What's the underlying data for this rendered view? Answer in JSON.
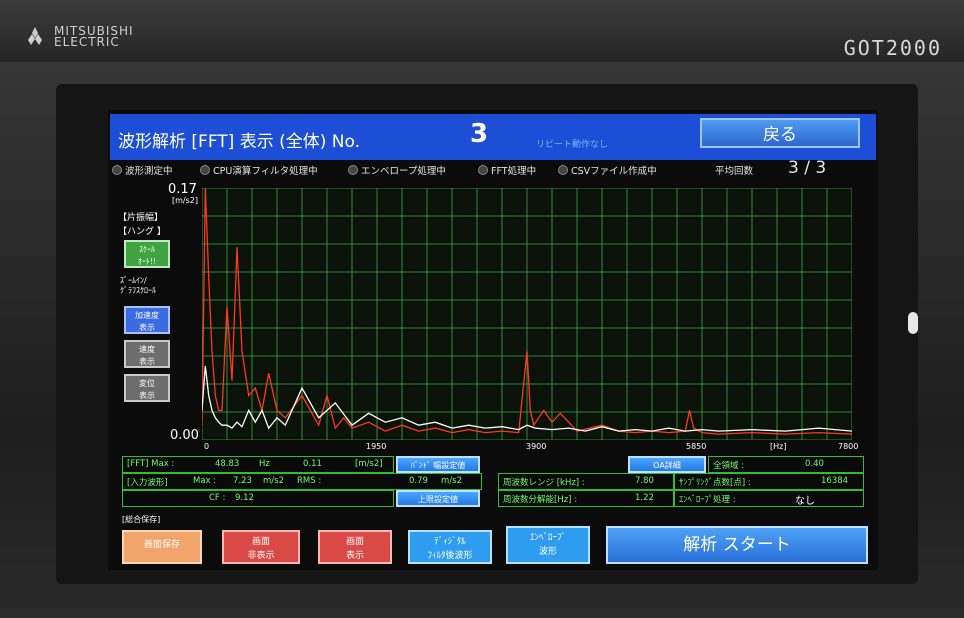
{
  "bezel": {
    "brand": "MITSUBISHI\nELECTRIC",
    "model": "GOT2000"
  },
  "header": {
    "title": "波形解析 [FFT] 表示 (全体) No.",
    "number": "3",
    "repeat_status": "リピート動作なし",
    "back_label": "戻る"
  },
  "status": {
    "items": [
      "波形測定中",
      "CPU演算フィルタ処理中",
      "エンベロープ処理中",
      "FFT処理中",
      "CSVファイル作成中"
    ],
    "avg_label": "平均回数",
    "avg_value": "3 / 3"
  },
  "left_panel": {
    "y_max": "0.17",
    "y_unit": "[m/s2]",
    "mode1": "【片振幅】",
    "mode2": "【ハング 】",
    "scale_btn": "ｽｹｰﾙ\nｵｰﾄ!!",
    "zoom_label": "ｽﾞｰﾑｲﾝ/\nｸﾞﾗﾌｽｸﾛｰﾙ",
    "accel_btn": "加速度\n表示",
    "vel_btn": "速度\n表示",
    "disp_btn": "変位\n表示",
    "y_min": "0.00"
  },
  "x_axis": {
    "ticks": [
      "0",
      "1950",
      "3900",
      "5850",
      "7800"
    ],
    "unit": "[Hz]"
  },
  "info": {
    "fft_label": "[FFT] Max :",
    "fft_freq": "48.83",
    "fft_freq_unit": "Hz",
    "fft_amp": "0.11",
    "fft_amp_unit": "[m/s2]",
    "band_btn": "ﾊﾞﾝﾄﾞ 幅設定値",
    "in_label": "[入力波形]",
    "max_label": "Max :",
    "in_max": "7.23",
    "in_max_unit": "m/s2",
    "rms_label": "RMS :",
    "rms": "0.79",
    "rms_unit": "m/s2",
    "cf_label": "CF :",
    "cf": "9.12",
    "upper_btn": "上限設定値",
    "oa_btn": "OA詳細",
    "all_label": "全領域 :",
    "all_value": "0.40",
    "freq_range_label": "周波数レンジ [kHz] :",
    "freq_range": "7.80",
    "sampling_label": "ｻﾝﾌﾟﾘﾝｸﾞ点数[点] :",
    "sampling": "16384",
    "freq_res_label": "周波数分解能[Hz] :",
    "freq_res": "1.22",
    "env_label": "ｴﾝﾍﾞﾛｰﾌﾟ処理 :",
    "env_value": "なし"
  },
  "bottom": {
    "note": "[総合保存]",
    "save_btn": "画面保存",
    "hide_btn": "画面\n非表示",
    "show_btn": "画面\n表示",
    "digital_btn": "ﾃﾞｨｼﾞﾀﾙ\nﾌｨﾙﾀ後波形",
    "envelope_btn": "ｴﾝﾍﾞﾛｰﾌﾟ\n波形",
    "start_btn": "解析 スタート"
  },
  "chart_data": {
    "type": "line",
    "xlabel": "[Hz]",
    "ylabel": "[m/s2]",
    "xlim": [
      0,
      7800
    ],
    "ylim": [
      0,
      0.17
    ],
    "grid": true,
    "series": [
      {
        "color": "#ff3a1a",
        "x": [
          0,
          40,
          80,
          120,
          160,
          200,
          240,
          300,
          360,
          420,
          480,
          560,
          640,
          720,
          800,
          900,
          1000,
          1200,
          1400,
          1500,
          1600,
          1700,
          1800,
          2000,
          2200,
          2400,
          2600,
          2800,
          3000,
          3200,
          3400,
          3600,
          3800,
          3900,
          3940,
          3980,
          4100,
          4200,
          4300,
          4500,
          4800,
          5000,
          5200,
          5400,
          5600,
          5800,
          5850,
          5900,
          6000,
          6200,
          6600,
          7000,
          7400,
          7800
        ],
        "y": [
          0.01,
          0.17,
          0.11,
          0.06,
          0.03,
          0.02,
          0.02,
          0.09,
          0.04,
          0.13,
          0.06,
          0.03,
          0.035,
          0.02,
          0.045,
          0.02,
          0.015,
          0.03,
          0.01,
          0.03,
          0.008,
          0.015,
          0.008,
          0.012,
          0.006,
          0.01,
          0.006,
          0.008,
          0.005,
          0.007,
          0.005,
          0.006,
          0.005,
          0.06,
          0.02,
          0.01,
          0.02,
          0.012,
          0.018,
          0.006,
          0.01,
          0.006,
          0.005,
          0.006,
          0.005,
          0.006,
          0.02,
          0.008,
          0.005,
          0.004,
          0.005,
          0.004,
          0.005,
          0.004
        ]
      },
      {
        "color": "#ffffff",
        "x": [
          0,
          40,
          80,
          120,
          160,
          200,
          240,
          300,
          360,
          420,
          480,
          560,
          640,
          720,
          800,
          900,
          1000,
          1200,
          1400,
          1600,
          1800,
          2000,
          2200,
          2400,
          2600,
          2800,
          3000,
          3200,
          3400,
          3600,
          3800,
          3900,
          4000,
          4200,
          4400,
          4600,
          4800,
          5000,
          5200,
          5400,
          5600,
          5800,
          6000,
          6200,
          6600,
          7000,
          7400,
          7800
        ],
        "y": [
          0.02,
          0.05,
          0.03,
          0.02,
          0.015,
          0.012,
          0.01,
          0.01,
          0.008,
          0.012,
          0.009,
          0.02,
          0.012,
          0.02,
          0.008,
          0.015,
          0.01,
          0.035,
          0.015,
          0.025,
          0.01,
          0.018,
          0.012,
          0.015,
          0.01,
          0.012,
          0.008,
          0.01,
          0.008,
          0.009,
          0.007,
          0.01,
          0.008,
          0.007,
          0.008,
          0.006,
          0.009,
          0.006,
          0.007,
          0.006,
          0.008,
          0.006,
          0.007,
          0.006,
          0.007,
          0.006,
          0.008,
          0.006
        ]
      }
    ]
  }
}
